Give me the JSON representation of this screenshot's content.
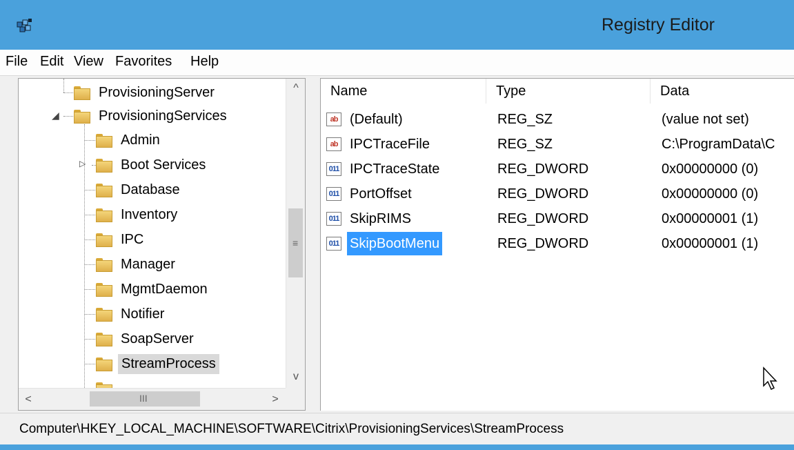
{
  "window": {
    "title": "Registry Editor",
    "accent_color": "#4aa1dc"
  },
  "menu": [
    "File",
    "Edit",
    "View",
    "Favorites",
    "Help"
  ],
  "tree": {
    "items": [
      {
        "label": "ProvisioningServer",
        "icon": "folder-icon",
        "expander": ""
      },
      {
        "label": "ProvisioningServices",
        "icon": "folder-icon",
        "expander": "expanded"
      },
      {
        "label": "Admin",
        "icon": "folder-icon",
        "expander": ""
      },
      {
        "label": "Boot Services",
        "icon": "folder-icon",
        "expander": "collapsed"
      },
      {
        "label": "Database",
        "icon": "folder-icon",
        "expander": ""
      },
      {
        "label": "Inventory",
        "icon": "folder-icon",
        "expander": ""
      },
      {
        "label": "IPC",
        "icon": "folder-icon",
        "expander": ""
      },
      {
        "label": "Manager",
        "icon": "folder-icon",
        "expander": ""
      },
      {
        "label": "MgmtDaemon",
        "icon": "folder-icon",
        "expander": ""
      },
      {
        "label": "Notifier",
        "icon": "folder-icon",
        "expander": ""
      },
      {
        "label": "SoapServer",
        "icon": "folder-icon",
        "expander": ""
      },
      {
        "label": "StreamProcess",
        "icon": "folder-icon",
        "expander": "",
        "selected": true
      }
    ],
    "scroll_grip": "≡",
    "hscroll_grip": "III"
  },
  "list": {
    "columns": [
      "Name",
      "Type",
      "Data"
    ],
    "rows": [
      {
        "icon": "string-value-icon",
        "name": "(Default)",
        "type": "REG_SZ",
        "data": "(value not set)"
      },
      {
        "icon": "string-value-icon",
        "name": "IPCTraceFile",
        "type": "REG_SZ",
        "data": "C:\\ProgramData\\C"
      },
      {
        "icon": "dword-value-icon",
        "name": "IPCTraceState",
        "type": "REG_DWORD",
        "data": "0x00000000 (0)"
      },
      {
        "icon": "dword-value-icon",
        "name": "PortOffset",
        "type": "REG_DWORD",
        "data": "0x00000000 (0)"
      },
      {
        "icon": "dword-value-icon",
        "name": "SkipRIMS",
        "type": "REG_DWORD",
        "data": "0x00000001 (1)"
      },
      {
        "icon": "dword-value-icon",
        "name": "SkipBootMenu",
        "type": "REG_DWORD",
        "data": "0x00000001 (1)",
        "selected": true
      }
    ]
  },
  "status": {
    "path": "Computer\\HKEY_LOCAL_MACHINE\\SOFTWARE\\Citrix\\ProvisioningServices\\StreamProcess"
  }
}
